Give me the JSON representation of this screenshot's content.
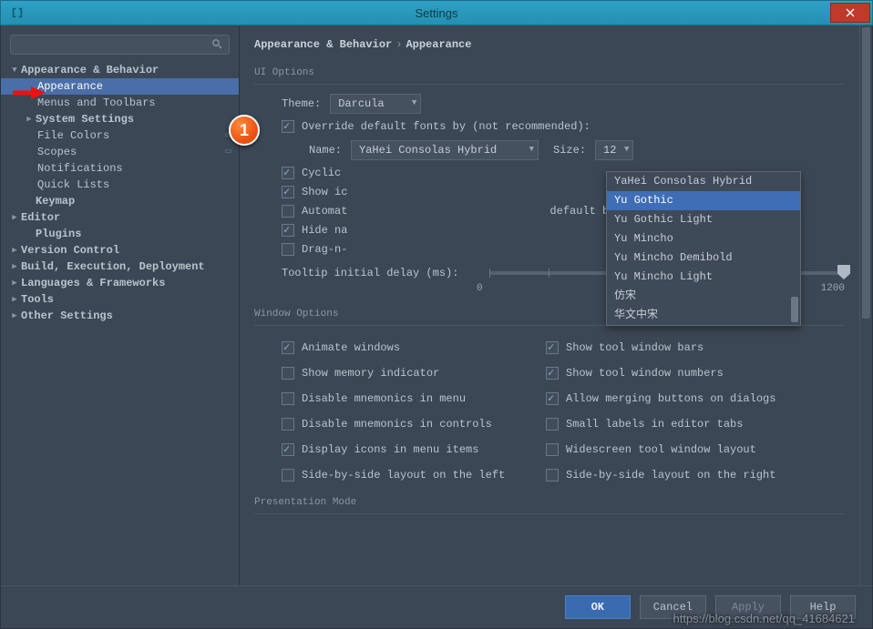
{
  "window": {
    "title": "Settings"
  },
  "search": {
    "placeholder": ""
  },
  "sidebar": {
    "top": "Appearance & Behavior",
    "items": [
      "Appearance",
      "Menus and Toolbars",
      "System Settings",
      "File Colors",
      "Scopes",
      "Notifications",
      "Quick Lists"
    ],
    "sections": [
      "Keymap",
      "Editor",
      "Plugins",
      "Version Control",
      "Build, Execution, Deployment",
      "Languages & Frameworks",
      "Tools",
      "Other Settings"
    ]
  },
  "breadcrumb": {
    "a": "Appearance & Behavior",
    "b": "Appearance"
  },
  "ui": {
    "group": "UI Options",
    "theme_label": "Theme:",
    "theme_value": "Darcula",
    "override_label": "Override default fonts by (not recommended):",
    "name_label": "Name:",
    "font_value": "YaHei Consolas Hybrid",
    "size_label": "Size:",
    "size_value": "12",
    "cyclic": "Cyclic",
    "show_icons": "Show ic",
    "automat": "Automat",
    "automat_rest": "default button",
    "hide_na": "Hide na",
    "drag_n": "Drag-n-",
    "tooltip_label": "Tooltip initial delay (ms):",
    "slider_min": "0",
    "slider_max": "1200"
  },
  "font_options": [
    "YaHei Consolas Hybrid",
    "Yu Gothic",
    "Yu Gothic Light",
    "Yu Mincho",
    "Yu Mincho Demibold",
    "Yu Mincho Light",
    "仿宋",
    "华文中宋"
  ],
  "win": {
    "group": "Window Options",
    "left": [
      {
        "c": true,
        "t": "Animate windows"
      },
      {
        "c": false,
        "t": "Show memory indicator"
      },
      {
        "c": false,
        "t": "Disable mnemonics in menu"
      },
      {
        "c": false,
        "t": "Disable mnemonics in controls"
      },
      {
        "c": true,
        "t": "Display icons in menu items"
      },
      {
        "c": false,
        "t": "Side-by-side layout on the left"
      }
    ],
    "right": [
      {
        "c": true,
        "t": "Show tool window bars"
      },
      {
        "c": true,
        "t": "Show tool window numbers"
      },
      {
        "c": true,
        "t": "Allow merging buttons on dialogs"
      },
      {
        "c": false,
        "t": "Small labels in editor tabs"
      },
      {
        "c": false,
        "t": "Widescreen tool window layout"
      },
      {
        "c": false,
        "t": "Side-by-side layout on the right"
      }
    ]
  },
  "pres": {
    "group": "Presentation Mode"
  },
  "footer": {
    "ok": "OK",
    "cancel": "Cancel",
    "apply": "Apply",
    "help": "Help"
  },
  "annotation": {
    "badge": "1"
  },
  "watermark": "https://blog.csdn.net/qq_41684621"
}
